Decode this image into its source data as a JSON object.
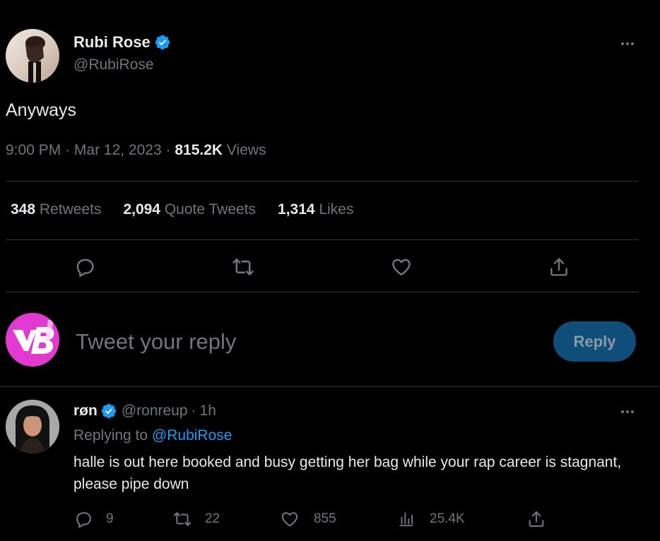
{
  "tweet": {
    "author_name": "Rubi Rose",
    "author_handle": "@RubiRose",
    "text": "Anyways",
    "time": "9:00 PM",
    "date": "Mar 12, 2023",
    "views_count": "815.2K",
    "views_label": "Views",
    "retweets_count": "348",
    "retweets_label": "Retweets",
    "quotes_count": "2,094",
    "quotes_label": "Quote Tweets",
    "likes_count": "1,314",
    "likes_label": "Likes"
  },
  "composer": {
    "placeholder": "Tweet your reply",
    "reply_button": "Reply"
  },
  "reply": {
    "author_name": "røn",
    "author_handle": "@ronreup",
    "time": "1h",
    "replying_to_label": "Replying to",
    "replying_to_handle": "@RubiRose",
    "text": "halle is out here booked and busy getting her bag while your rap career is stagnant, please pipe down",
    "reply_count": "9",
    "retweet_count": "22",
    "like_count": "855",
    "view_count": "25.4K"
  },
  "colors": {
    "accent": "#1d9bf0",
    "verified": "#1d9bf0",
    "reply_button_bg": "#0f4e78",
    "muted_text": "#71767b",
    "divider": "#2f3336"
  },
  "icons": {
    "verified": "verified-badge-icon",
    "more": "more-icon",
    "reply": "reply-icon",
    "retweet": "retweet-icon",
    "like": "heart-icon",
    "share": "share-icon",
    "views": "views-icon"
  }
}
